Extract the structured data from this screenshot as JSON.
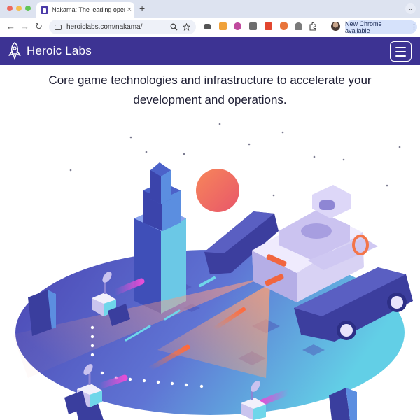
{
  "browser": {
    "tab_title": "Nakama: The leading open so",
    "tab_close": "×",
    "new_tab": "+",
    "tab_menu": "⌄",
    "url": "heroiclabs.com/nakama/",
    "update_label": "New Chrome available",
    "update_dots": "⋮"
  },
  "nav": {
    "back": "←",
    "forward": "→",
    "reload": "↻"
  },
  "site": {
    "brand": "Heroic Labs"
  },
  "hero": {
    "tagline_line1": "Core game technologies and infrastructure to accelerate your",
    "tagline_line2": "development and operations."
  },
  "colors": {
    "header_bg": "#3d3393",
    "sun": "#f26a4f",
    "floor_dark": "#4a45b0",
    "floor_light": "#5ec8e4"
  }
}
